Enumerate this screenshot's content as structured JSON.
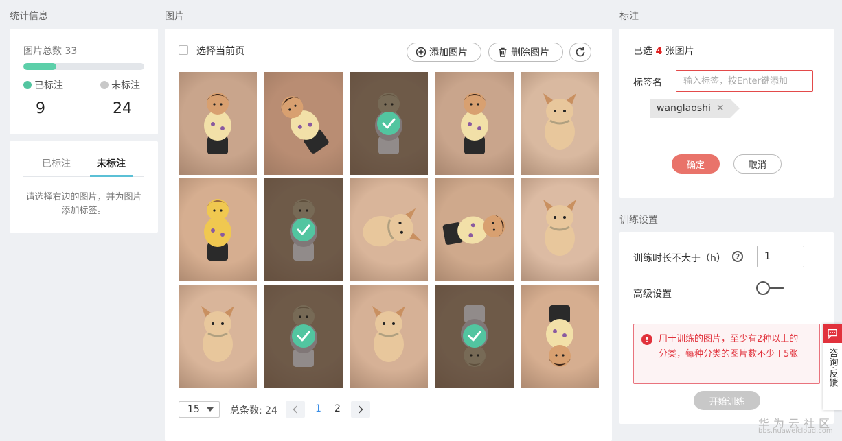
{
  "sections": {
    "stats": "统计信息",
    "images": "图片",
    "label": "标注",
    "training": "训练设置"
  },
  "stats": {
    "total_label": "图片总数 33",
    "progress_fraction": 0.27,
    "labeled_label": "已标注",
    "unlabeled_label": "未标注",
    "labeled_count": "9",
    "unlabeled_count": "24",
    "labeled_color": "#52c5a0",
    "unlabeled_color": "#c8c8c8"
  },
  "tabs": {
    "items": [
      "已标注",
      "未标注"
    ],
    "active_index": 1,
    "hint": "请选择右边的图片，并为图片添加标签。"
  },
  "images": {
    "select_page_label": "选择当前页",
    "add_button": "添加图片",
    "delete_button": "删除图片",
    "grid": [
      {
        "figure": "girl-figurine",
        "bg": "#c9a58c",
        "selected": false
      },
      {
        "figure": "girl-figurine-tilted",
        "bg": "#b98d73",
        "selected": false
      },
      {
        "figure": "boy-figurine",
        "bg": "#a88a74",
        "selected": true
      },
      {
        "figure": "girl-figurine",
        "bg": "#c9a58c",
        "selected": false
      },
      {
        "figure": "dog-figurine",
        "bg": "#d9b9a0",
        "selected": false
      },
      {
        "figure": "tiger-figurine",
        "bg": "#d6ae90",
        "selected": false
      },
      {
        "figure": "boy-figurine",
        "bg": "#a88a74",
        "selected": true
      },
      {
        "figure": "dog-figurine-lying",
        "bg": "#d9b59a",
        "selected": false
      },
      {
        "figure": "girl-figurine-lying",
        "bg": "#cfa98c",
        "selected": false
      },
      {
        "figure": "dog-figurine",
        "bg": "#dcbba3",
        "selected": false
      },
      {
        "figure": "dog-figurine-back",
        "bg": "#d9b59a",
        "selected": false
      },
      {
        "figure": "boy-figurine",
        "bg": "#a88a74",
        "selected": true
      },
      {
        "figure": "dog-figurine-front",
        "bg": "#d6b196",
        "selected": false
      },
      {
        "figure": "boy-figurine-upside-down",
        "bg": "#a88a74",
        "selected": true
      },
      {
        "figure": "girl-figurine-upside-down",
        "bg": "#d6ae90",
        "selected": false
      }
    ],
    "page_size": "15",
    "total_text": "总条数: 24",
    "pages": [
      "1",
      "2"
    ],
    "current_page": "1"
  },
  "label": {
    "selected_prefix": "已选 ",
    "selected_count": "4",
    "selected_suffix": " 张图片",
    "name_label": "标签名",
    "input_placeholder": "输入标签，按Enter键添加",
    "tag": "wanglaoshi",
    "confirm": "确定",
    "cancel": "取消"
  },
  "training": {
    "duration_label": "训练时长不大于（h）",
    "duration_value": "1",
    "advanced_label": "高级设置",
    "advanced_on": false,
    "alert": "用于训练的图片，至少有2种以上的分类，每种分类的图片数不少于5张",
    "start_button": "开始训练"
  },
  "float": {
    "text": "咨询·反馈"
  },
  "watermark": {
    "brand": "华为云社区",
    "url": "bbs.huaweicloud.com"
  }
}
